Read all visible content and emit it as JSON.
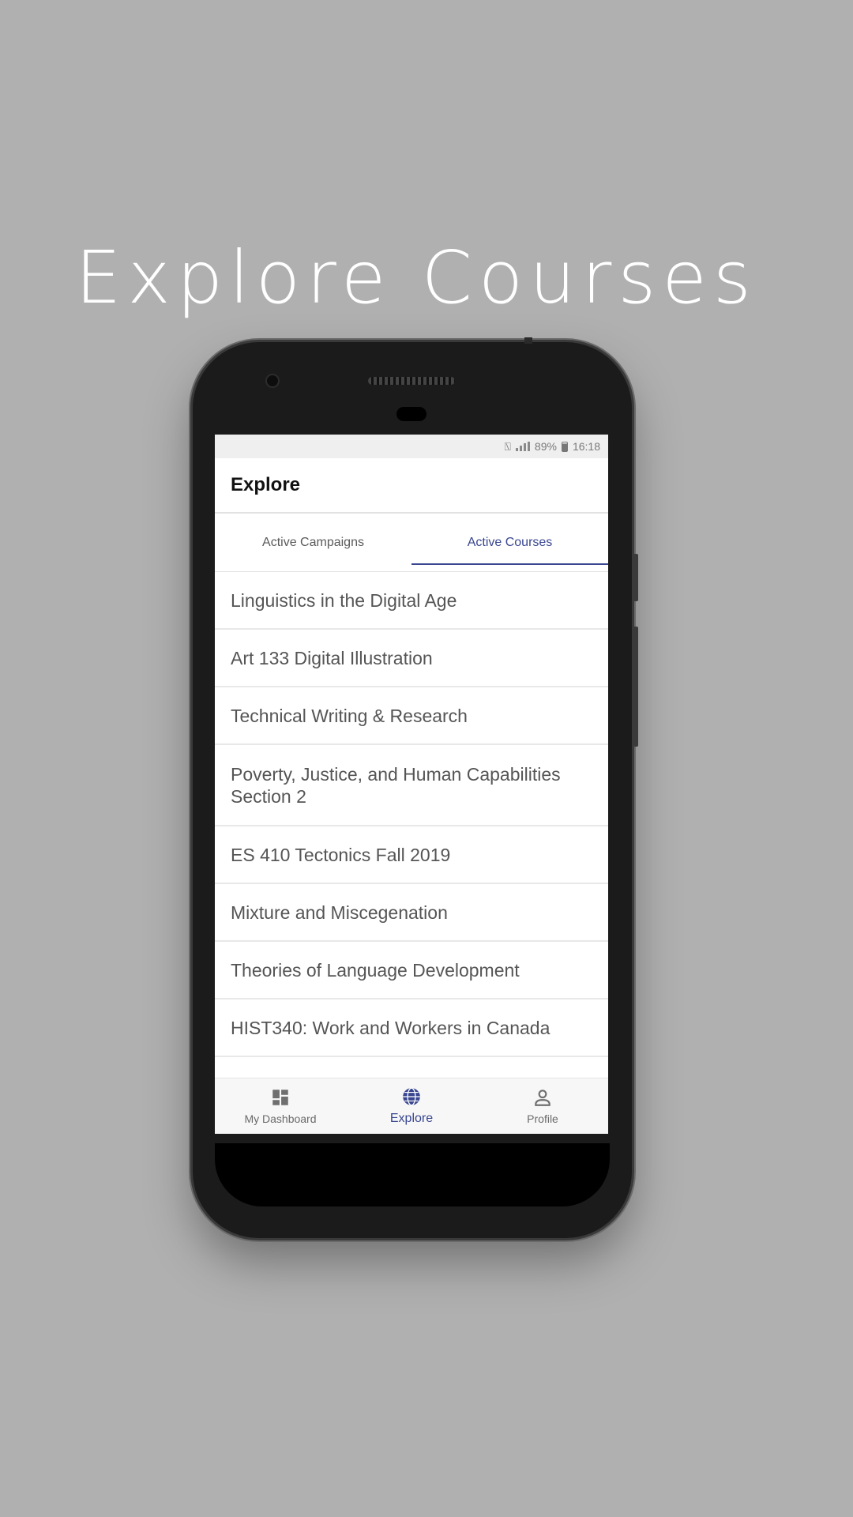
{
  "headline": "Explore Courses",
  "status_bar": {
    "battery": "89%",
    "time": "16:18"
  },
  "app_bar": {
    "title": "Explore"
  },
  "tabs": [
    {
      "label": "Active Campaigns",
      "active": false
    },
    {
      "label": "Active Courses",
      "active": true
    }
  ],
  "courses": [
    "Linguistics in the Digital Age",
    "Art 133 Digital Illustration",
    "Technical Writing & Research",
    "Poverty, Justice, and Human Capabilities Section 2",
    "ES 410 Tectonics Fall 2019",
    "Mixture and Miscegenation",
    "Theories of Language Development",
    "HIST340: Work and Workers in Canada"
  ],
  "bottom_nav": [
    {
      "label": "My Dashboard",
      "icon": "dashboard-icon",
      "active": false
    },
    {
      "label": "Explore",
      "icon": "globe-icon",
      "active": true
    },
    {
      "label": "Profile",
      "icon": "person-icon",
      "active": false
    }
  ],
  "colors": {
    "background": "#b0b0b0",
    "accent": "#3a4790",
    "list_text": "#555555"
  }
}
